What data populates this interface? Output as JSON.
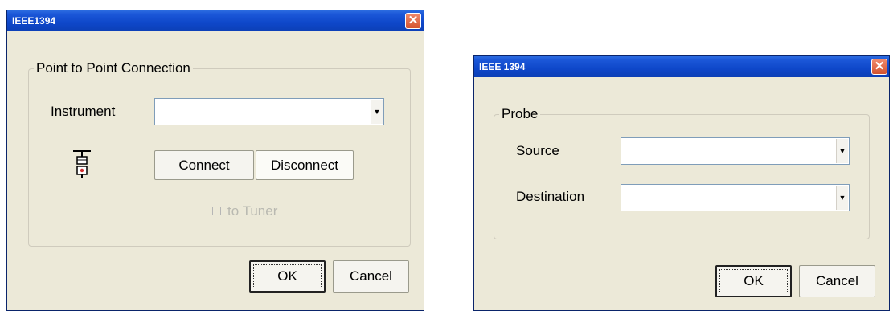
{
  "dialog1": {
    "title": "IEEE1394",
    "close_glyph": "✕",
    "group_label": "Point to Point Connection",
    "instrument_label": "Instrument",
    "instrument_value": "",
    "connect_label": "Connect",
    "disconnect_label": "Disconnect",
    "to_tuner_label": "to Tuner",
    "to_tuner_checked": false,
    "ok_label": "OK",
    "cancel_label": "Cancel"
  },
  "dialog2": {
    "title": "IEEE 1394",
    "close_glyph": "✕",
    "group_label": "Probe",
    "source_label": "Source",
    "source_value": "",
    "destination_label": "Destination",
    "destination_value": "",
    "ok_label": "OK",
    "cancel_label": "Cancel"
  },
  "icons": {
    "connection_icon": "connection-icon",
    "dropdown_arrow": "▼"
  },
  "colors": {
    "titlebar": "#0e47c9",
    "dialog_bg": "#ece9d8",
    "close_button": "#d4532f",
    "disabled_text": "#b9b9b1"
  }
}
